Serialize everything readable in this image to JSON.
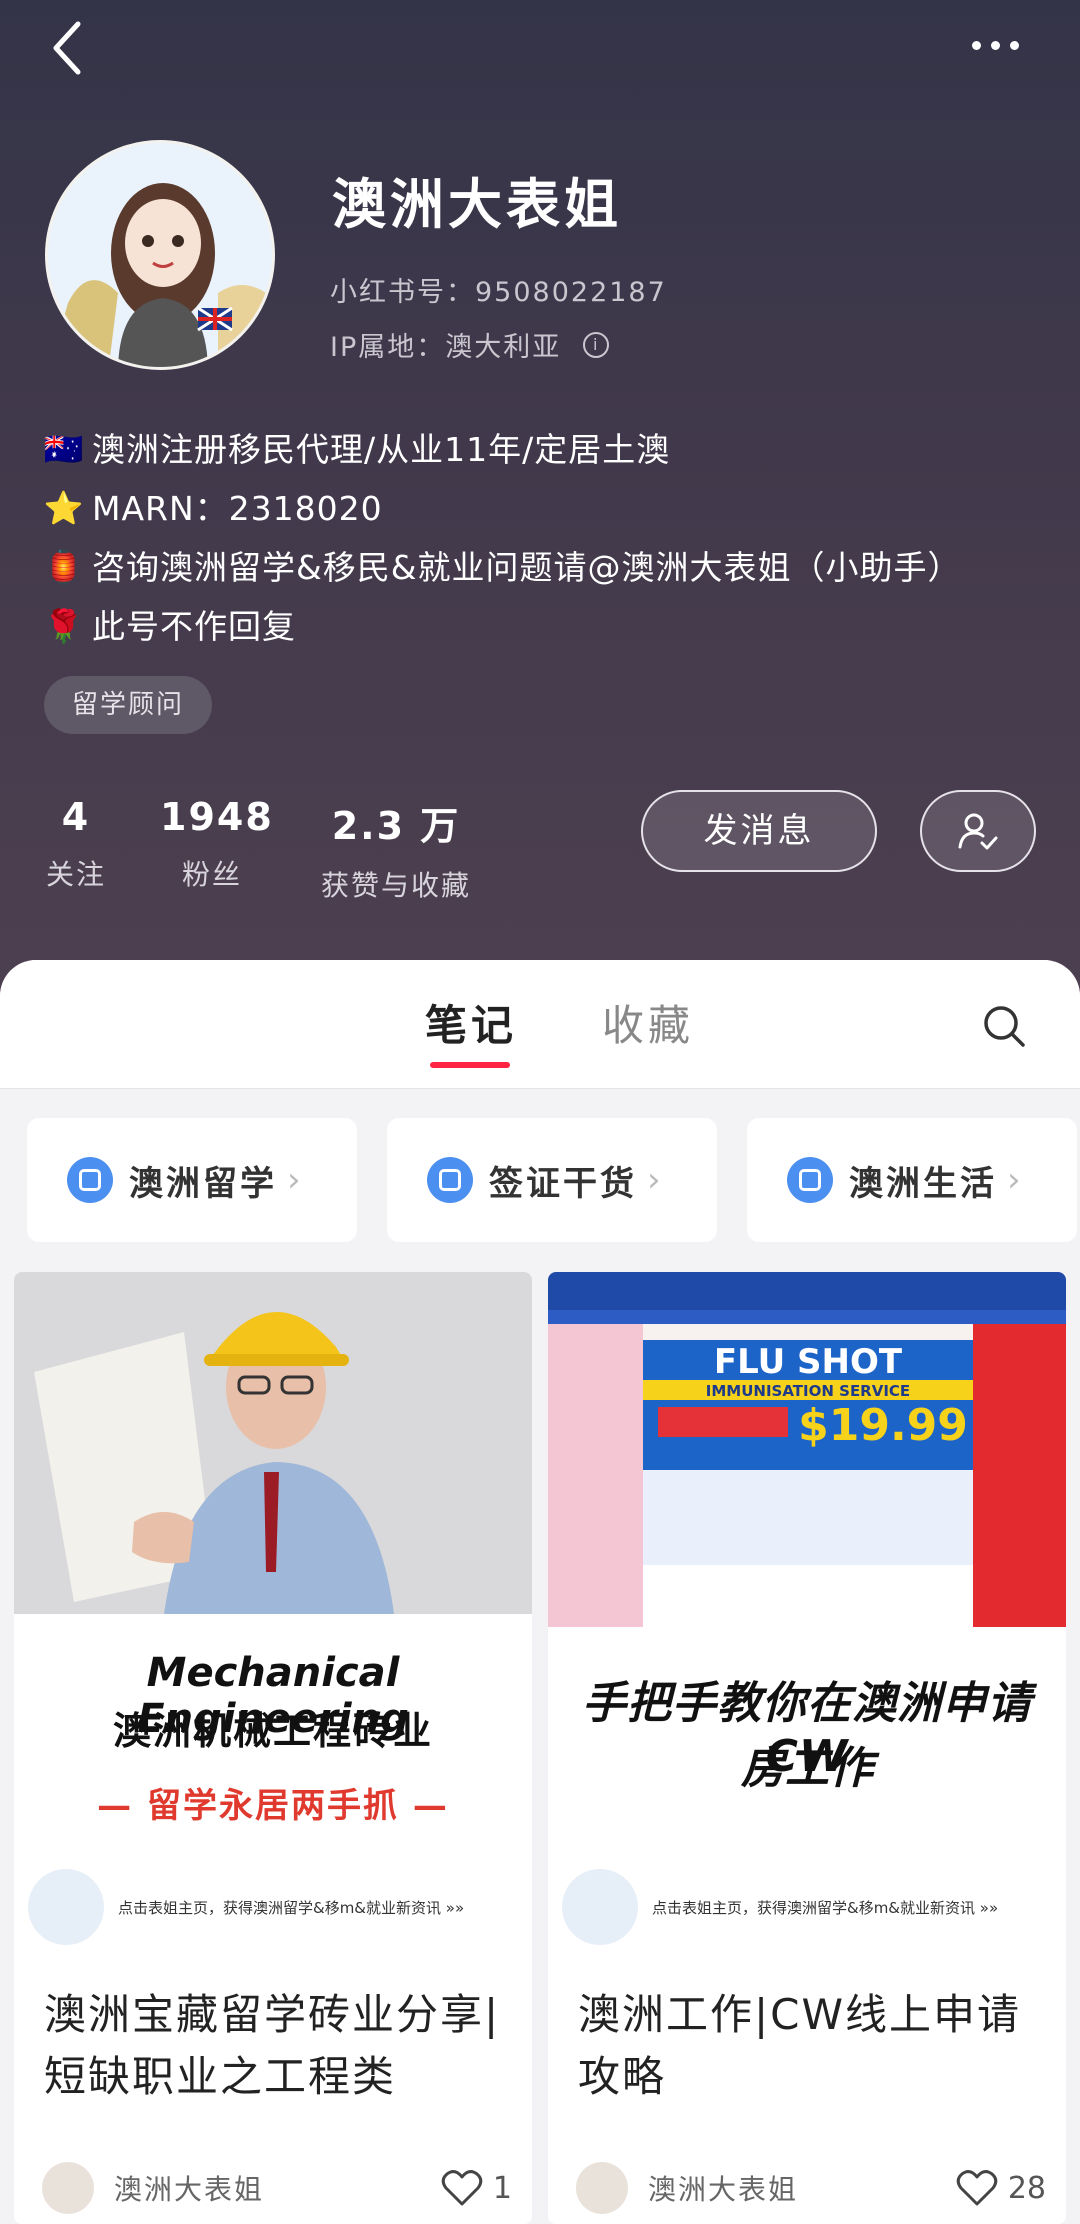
{
  "profile": {
    "name": "澳洲大表姐",
    "red_id": "小红书号：9508022187",
    "ip_location": "IP属地：澳大利亚",
    "bio": [
      {
        "emoji": "🇦🇺",
        "text": "澳洲注册移民代理/从业11年/定居土澳"
      },
      {
        "emoji": "⭐",
        "text": "MARN：2318020"
      },
      {
        "emoji": "🏮",
        "text": "咨询澳洲留学&移民&就业问题请@澳洲大表姐（小助手）"
      },
      {
        "emoji": "🌹",
        "text": "此号不作回复"
      }
    ],
    "tag": "留学顾问"
  },
  "stats": {
    "following": {
      "value": "4",
      "label": "关注"
    },
    "followers": {
      "value": "1948",
      "label": "粉丝"
    },
    "likes": {
      "value": "2.3 万",
      "label": "获赞与收藏"
    }
  },
  "actions": {
    "message_label": "发消息"
  },
  "tabs": {
    "notes": "笔记",
    "collections": "收藏"
  },
  "collections": [
    {
      "label": "澳洲留学"
    },
    {
      "label": "签证干货"
    },
    {
      "label": "澳洲生活"
    }
  ],
  "notes": [
    {
      "cover_heading_en": "Mechanical Engineering",
      "cover_heading_cn": "澳洲机械工程砖业",
      "cover_sub": "— 留学永居两手抓 —",
      "cover_promo": "点击表姐主页，获得澳洲留学&移m&就业新资讯 »»",
      "title": "澳洲宝藏留学砖业分享|短缺职业之工程类",
      "author": "澳洲大表姐",
      "likes": "1"
    },
    {
      "cover_banner": "FLU SHOT",
      "cover_banner_sub": "IMMUNISATION SERVICE",
      "cover_price": "$19.99",
      "cover_heading": "手把手教你在澳洲申请CW",
      "cover_heading_2": "房工作",
      "cover_promo": "点击表姐主页，获得澳洲留学&移m&就业新资讯 »»",
      "title": "澳洲工作|CW线上申请攻略",
      "author": "澳洲大表姐",
      "likes": "28"
    }
  ],
  "colors": {
    "accent": "#ff2442",
    "chip_icon": "#4b8ff0",
    "header_bg": "#3a3548"
  }
}
